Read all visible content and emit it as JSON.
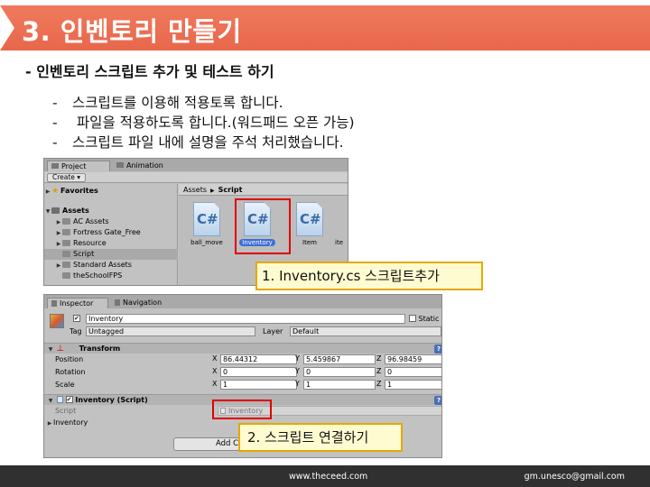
{
  "slide": {
    "title": "3. 인벤토리 만들기",
    "subtitle": "- 인벤토리 스크립트 추가 및 테스트 하기",
    "bullets": [
      "스크립트를 이용해 적용토록 합니다.",
      " 파일을 적용하도록 합니다.(워드패드 오픈 가능)",
      "스크립트 파일 내에 설명을 주석 처리했습니다."
    ],
    "callout_1": "1. Inventory.cs 스크립트추가",
    "callout_2": "2. 스크립트 연결하기",
    "footer_site": "www.theceed.com",
    "footer_email": "gm.unesco@gmail.com"
  },
  "project_panel": {
    "tabs": [
      "Project",
      "Animation"
    ],
    "create_label": "Create ▾",
    "favorites_label": "Favorites",
    "assets_label": "Assets",
    "folders": [
      "AC Assets",
      "Fortress Gate_Free",
      "Resource",
      "Script",
      "Standard Assets",
      "theSchoolFPS"
    ],
    "selected_folder": "Script",
    "breadcrumb": [
      "Assets",
      "Script"
    ],
    "files": [
      {
        "name": "ball_move",
        "icon": "csharp-script-icon",
        "glyph": "C#"
      },
      {
        "name": "Inventory",
        "icon": "csharp-script-icon",
        "glyph": "C#",
        "selected": true
      },
      {
        "name": "Item",
        "icon": "csharp-script-icon",
        "glyph": "C#"
      },
      {
        "name": "ite",
        "icon": "csharp-script-icon",
        "glyph": ""
      }
    ]
  },
  "inspector": {
    "tabs": [
      "Inspector",
      "Navigation"
    ],
    "object_name": "Inventory",
    "static_label": "Static",
    "tag_label": "Tag",
    "tag_value": "Untagged",
    "layer_label": "Layer",
    "layer_value": "Default",
    "transform": {
      "header": "Transform",
      "rows": [
        {
          "label": "Position",
          "x": "86.44312",
          "y": "5.459867",
          "z": "96.98459"
        },
        {
          "label": "Rotation",
          "x": "0",
          "y": "0",
          "z": "0"
        },
        {
          "label": "Scale",
          "x": "1",
          "y": "1",
          "z": "1"
        }
      ]
    },
    "component": {
      "header": "Inventory (Script)",
      "script_label": "Script",
      "script_value": "Inventory",
      "field_label": "Inventory"
    },
    "add_button": "Add C"
  },
  "colors": {
    "title_band": "#e8674b",
    "highlight_box": "#e00000",
    "callout_fill": "#fffbd0",
    "callout_border": "#e5a800",
    "footer": "#303030"
  }
}
